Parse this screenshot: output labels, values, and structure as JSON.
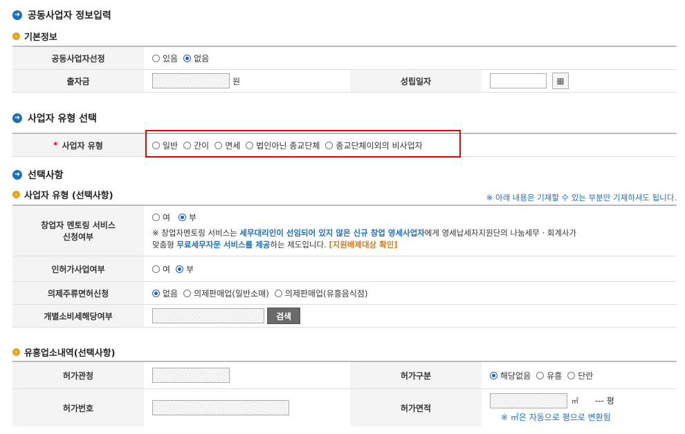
{
  "sec1": {
    "title": "공동사업자 정보입력",
    "sub": "기본정보",
    "row1_label": "공동사업자선정",
    "row1_opts": [
      "있음",
      "없음"
    ],
    "row2_label": "출자금",
    "row2_unit": "원",
    "row2b_label": "성립일자"
  },
  "sec2": {
    "title": "사업자 유형 선택",
    "req_mark": "*",
    "label": "사업자 유형",
    "opts": [
      "일반",
      "간이",
      "면세",
      "법인아닌 종교단체",
      "종교단체이외의 비사업자"
    ]
  },
  "sec3": {
    "title": "선택사항",
    "sub": "사업자 유형 (선택사항)",
    "notice": "※ 아래 내용은 기재할 수 있는 부분만 기재하셔도 됩니다.",
    "mentor_label1": "창업자 멘토링 서비스",
    "mentor_label2": "신청여부",
    "yn": [
      "여",
      "부"
    ],
    "mentor_desc_a": "※ 창업자멘토링 서비스는 ",
    "mentor_desc_b": "세무대리인이 선임되어 있지 않은 신규 창업 영세사업자",
    "mentor_desc_c": "에게 영세납세자지원단의 나눔세무 · 회계사가",
    "mentor_desc_d": "맞춤형 ",
    "mentor_desc_e": "무료세무자문 서비스를 제공",
    "mentor_desc_f": "하는 제도입니다.",
    "mentor_desc_g": "[지원배제대상 확인]",
    "license_label": "인허가사업여부",
    "liquor_label": "의제주류면허신청",
    "liquor_opts": [
      "없음",
      "의제판매업(일반소매)",
      "의제판매업(유흥음식점)"
    ],
    "excise_label": "개별소비세해당여부",
    "search_btn": "검색"
  },
  "sec4": {
    "title": "유흥업소내역(선택사항)",
    "office_label": "허가관청",
    "kind_label": "허가구분",
    "kind_opts": [
      "해당없음",
      "유흥",
      "단란"
    ],
    "no_label": "허가번호",
    "area_label": "허가면적",
    "area_unit": "㎡",
    "pyeong_text": "--- 평",
    "area_note": "※ ㎡은 자동으로 평으로 변환됨"
  }
}
